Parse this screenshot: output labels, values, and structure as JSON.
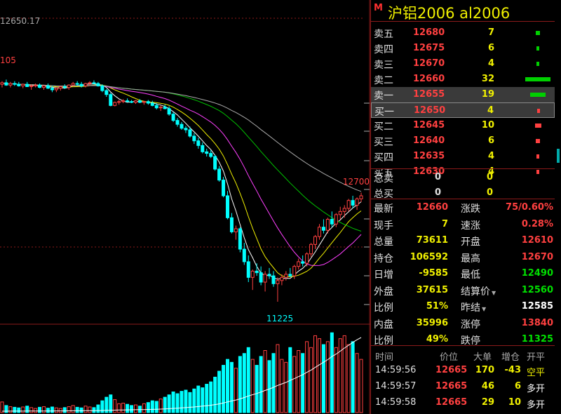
{
  "header": {
    "market_badge": "M",
    "title": "沪铝2006  al2006"
  },
  "colors": {
    "up": "#ff4040",
    "down": "#00ffff",
    "volume": "#f0f000",
    "label": "#e0e0e0",
    "green": "#00e000",
    "grid": "#8b1a1a"
  },
  "order_book": {
    "asks": [
      {
        "label": "卖五",
        "price": "12680",
        "vol": "7",
        "bar": 0.15,
        "bar_color": "#00d000"
      },
      {
        "label": "卖四",
        "price": "12675",
        "vol": "6",
        "bar": 0.12,
        "bar_color": "#00d000"
      },
      {
        "label": "卖三",
        "price": "12670",
        "vol": "4",
        "bar": 0.08,
        "bar_color": "#00d000"
      },
      {
        "label": "卖二",
        "price": "12660",
        "vol": "32",
        "bar": 1.0,
        "bar_color": "#00d000"
      },
      {
        "label": "卖一",
        "price": "12655",
        "vol": "19",
        "bar": 0.6,
        "bar_color": "#00d000"
      }
    ],
    "bids": [
      {
        "label": "买一",
        "price": "12650",
        "vol": "4",
        "bar": 0.08,
        "bar_color": "#ff4040"
      },
      {
        "label": "买二",
        "price": "12645",
        "vol": "10",
        "bar": 0.25,
        "bar_color": "#ff4040"
      },
      {
        "label": "买三",
        "price": "12640",
        "vol": "6",
        "bar": 0.15,
        "bar_color": "#ff4040"
      },
      {
        "label": "买四",
        "price": "12635",
        "vol": "4",
        "bar": 0.08,
        "bar_color": "#ff4040"
      },
      {
        "label": "买五",
        "price": "12630",
        "vol": "4",
        "bar": 0.08,
        "bar_color": "#ff4040"
      }
    ]
  },
  "totals": [
    {
      "label": "总卖",
      "v1": "0",
      "v2": "0"
    },
    {
      "label": "总买",
      "v1": "0",
      "v2": "0"
    }
  ],
  "stats": [
    {
      "l1": "最新",
      "v1": "12660",
      "c1": "#ff4040",
      "l2": "涨跌",
      "v2": "75/0.60%",
      "c2": "#ff4040"
    },
    {
      "l1": "现手",
      "v1": "7",
      "c1": "#f0f000",
      "l2": "速涨",
      "v2": "0.28%",
      "c2": "#ff4040"
    },
    {
      "l1": "总量",
      "v1": "73611",
      "c1": "#f0f000",
      "l2": "开盘",
      "v2": "12610",
      "c2": "#ff4040"
    },
    {
      "l1": "持仓",
      "v1": "106592",
      "c1": "#f0f000",
      "l2": "最高",
      "v2": "12670",
      "c2": "#ff4040"
    },
    {
      "l1": "日增",
      "v1": "-9585",
      "c1": "#f0f000",
      "l2": "最低",
      "v2": "12490",
      "c2": "#00e000"
    },
    {
      "l1": "外盘",
      "v1": "37615",
      "c1": "#f0f000",
      "l2": "结算价",
      "v2": "12560",
      "c2": "#00e000"
    },
    {
      "l1": "比例",
      "v1": "51%",
      "c1": "#f0f000",
      "l2": "昨结",
      "v2": "12585",
      "c2": "#ffffff"
    },
    {
      "l1": "内盘",
      "v1": "35996",
      "c1": "#f0f000",
      "l2": "涨停",
      "v2": "13840",
      "c2": "#ff4040"
    },
    {
      "l1": "比例",
      "v1": "49%",
      "c1": "#f0f000",
      "l2": "跌停",
      "v2": "11325",
      "c2": "#00e000"
    }
  ],
  "ticks": {
    "headers": [
      "时间",
      "价位",
      "大单",
      "增仓",
      "开平"
    ],
    "rows": [
      {
        "time": "14:59:56",
        "price": "12665",
        "big": "170",
        "oi": "-43",
        "oi_color": "#f0f000",
        "type": "空平",
        "type_color": "#f0f000"
      },
      {
        "time": "14:59:57",
        "price": "12665",
        "big": "46",
        "oi": "6",
        "oi_color": "#f0f000",
        "type": "多开",
        "type_color": "#ffffff"
      },
      {
        "time": "14:59:58",
        "price": "12665",
        "big": "29",
        "oi": "10",
        "oi_color": "#f0f000",
        "type": "多开",
        "type_color": "#ffffff"
      }
    ]
  },
  "chart": {
    "top_left_label": "12650.17",
    "left_label": "105",
    "high_label": "12700",
    "low_label": "11225"
  },
  "chart_data": {
    "type": "candlestick",
    "price_axis": [
      11225,
      12700
    ],
    "candles": [
      [
        12610,
        12630,
        12590,
        12620
      ],
      [
        12620,
        12640,
        12600,
        12605
      ],
      [
        12605,
        12625,
        12590,
        12615
      ],
      [
        12615,
        12630,
        12600,
        12610
      ],
      [
        12610,
        12625,
        12595,
        12600
      ],
      [
        12600,
        12615,
        12585,
        12610
      ],
      [
        12610,
        12625,
        12595,
        12595
      ],
      [
        12595,
        12610,
        12575,
        12600
      ],
      [
        12600,
        12615,
        12590,
        12605
      ],
      [
        12605,
        12615,
        12585,
        12590
      ],
      [
        12590,
        12605,
        12575,
        12600
      ],
      [
        12600,
        12615,
        12580,
        12585
      ],
      [
        12585,
        12600,
        12560,
        12575
      ],
      [
        12575,
        12590,
        12560,
        12585
      ],
      [
        12585,
        12600,
        12570,
        12595
      ],
      [
        12595,
        12610,
        12580,
        12590
      ],
      [
        12590,
        12610,
        12575,
        12605
      ],
      [
        12605,
        12625,
        12595,
        12615
      ],
      [
        12615,
        12630,
        12600,
        12610
      ],
      [
        12610,
        12625,
        12590,
        12600
      ],
      [
        12600,
        12620,
        12590,
        12615
      ],
      [
        12615,
        12630,
        12600,
        12620
      ],
      [
        12620,
        12635,
        12610,
        12615
      ],
      [
        12615,
        12625,
        12595,
        12600
      ],
      [
        12600,
        12610,
        12560,
        12570
      ],
      [
        12570,
        12580,
        12530,
        12545
      ],
      [
        12545,
        12555,
        12470,
        12475
      ],
      [
        12475,
        12500,
        12470,
        12495
      ],
      [
        12495,
        12510,
        12480,
        12500
      ],
      [
        12500,
        12515,
        12490,
        12505
      ],
      [
        12505,
        12520,
        12495,
        12500
      ],
      [
        12500,
        12510,
        12490,
        12495
      ],
      [
        12495,
        12510,
        12485,
        12505
      ],
      [
        12505,
        12515,
        12490,
        12495
      ],
      [
        12495,
        12505,
        12480,
        12500
      ],
      [
        12500,
        12510,
        12480,
        12490
      ],
      [
        12490,
        12505,
        12470,
        12475
      ],
      [
        12475,
        12490,
        12450,
        12460
      ],
      [
        12460,
        12475,
        12440,
        12465
      ],
      [
        12465,
        12480,
        12450,
        12455
      ],
      [
        12455,
        12470,
        12410,
        12420
      ],
      [
        12420,
        12435,
        12370,
        12380
      ],
      [
        12380,
        12395,
        12340,
        12355
      ],
      [
        12355,
        12370,
        12320,
        12330
      ],
      [
        12330,
        12345,
        12300,
        12320
      ],
      [
        12320,
        12340,
        12270,
        12280
      ],
      [
        12280,
        12300,
        12230,
        12250
      ],
      [
        12250,
        12270,
        12200,
        12220
      ],
      [
        12220,
        12240,
        12170,
        12180
      ],
      [
        12180,
        12200,
        12150,
        12170
      ],
      [
        12170,
        12190,
        12140,
        12150
      ],
      [
        12150,
        12160,
        12060,
        12070
      ],
      [
        12070,
        12090,
        11990,
        12000
      ],
      [
        12000,
        12020,
        11890,
        11900
      ],
      [
        11900,
        11930,
        11750,
        11760
      ],
      [
        11760,
        11790,
        11660,
        11670
      ],
      [
        11670,
        11710,
        11620,
        11690
      ],
      [
        11690,
        11700,
        11540,
        11560
      ],
      [
        11560,
        11600,
        11460,
        11480
      ],
      [
        11480,
        11520,
        11350,
        11380
      ],
      [
        11380,
        11430,
        11300,
        11420
      ],
      [
        11420,
        11470,
        11390,
        11410
      ],
      [
        11410,
        11450,
        11330,
        11350
      ],
      [
        11350,
        11420,
        11290,
        11400
      ],
      [
        11400,
        11440,
        11370,
        11390
      ],
      [
        11390,
        11420,
        11320,
        11340
      ],
      [
        11340,
        11380,
        11225,
        11360
      ],
      [
        11360,
        11400,
        11330,
        11380
      ],
      [
        11380,
        11420,
        11360,
        11400
      ],
      [
        11400,
        11440,
        11380,
        11390
      ],
      [
        11390,
        11460,
        11370,
        11450
      ],
      [
        11450,
        11500,
        11430,
        11480
      ],
      [
        11480,
        11520,
        11450,
        11470
      ],
      [
        11470,
        11540,
        11450,
        11530
      ],
      [
        11530,
        11600,
        11510,
        11590
      ],
      [
        11590,
        11650,
        11560,
        11640
      ],
      [
        11640,
        11720,
        11620,
        11700
      ],
      [
        11700,
        11750,
        11660,
        11680
      ],
      [
        11680,
        11760,
        11660,
        11750
      ],
      [
        11750,
        11800,
        11700,
        11720
      ],
      [
        11720,
        11790,
        11700,
        11780
      ],
      [
        11780,
        11830,
        11750,
        11800
      ],
      [
        11800,
        11840,
        11760,
        11820
      ],
      [
        11820,
        11880,
        11800,
        11870
      ],
      [
        11870,
        11900,
        11820,
        11840
      ],
      [
        11840,
        11890,
        11810,
        11880
      ],
      [
        11880,
        11920,
        11860,
        11900
      ]
    ],
    "volume": [
      180,
      120,
      100,
      90,
      80,
      95,
      110,
      85,
      70,
      90,
      100,
      75,
      95,
      80,
      70,
      85,
      100,
      120,
      90,
      80,
      110,
      95,
      85,
      130,
      200,
      260,
      300,
      220,
      150,
      160,
      140,
      120,
      130,
      110,
      150,
      170,
      200,
      190,
      230,
      260,
      300,
      350,
      320,
      360,
      380,
      340,
      400,
      450,
      420,
      480,
      520,
      600,
      700,
      800,
      900,
      850,
      750,
      950,
      1000,
      1100,
      900,
      800,
      950,
      1050,
      880,
      1000,
      1150,
      900,
      850,
      1100,
      950,
      1050,
      1000,
      1200,
      1100,
      1300,
      1250,
      1150,
      1200,
      1350,
      1100,
      1250,
      1300,
      1150,
      1200,
      1000,
      900
    ],
    "volume_axis": [
      0,
      1400
    ]
  }
}
